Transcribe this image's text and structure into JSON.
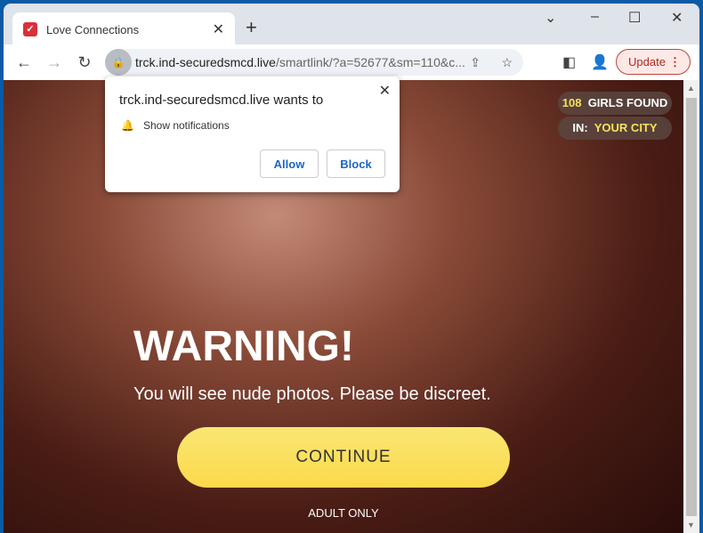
{
  "browser": {
    "tab_title": "Love Connections",
    "url_host": "trck.ind-securedsmcd.live",
    "url_path": "/smartlink/?a=52677&sm=110&c...",
    "update_label": "Update"
  },
  "popup": {
    "title": "trck.ind-securedsmcd.live wants to",
    "permission": "Show notifications",
    "allow": "Allow",
    "block": "Block"
  },
  "page": {
    "girls_count": "108",
    "girls_label": "GIRLS FOUND",
    "in_label": "IN:",
    "city": "YOUR CITY",
    "warning": "WARNING!",
    "subtitle": "You will see nude photos. Please be discreet.",
    "continue": "CONTINUE",
    "adult_only": "ADULT ONLY"
  }
}
